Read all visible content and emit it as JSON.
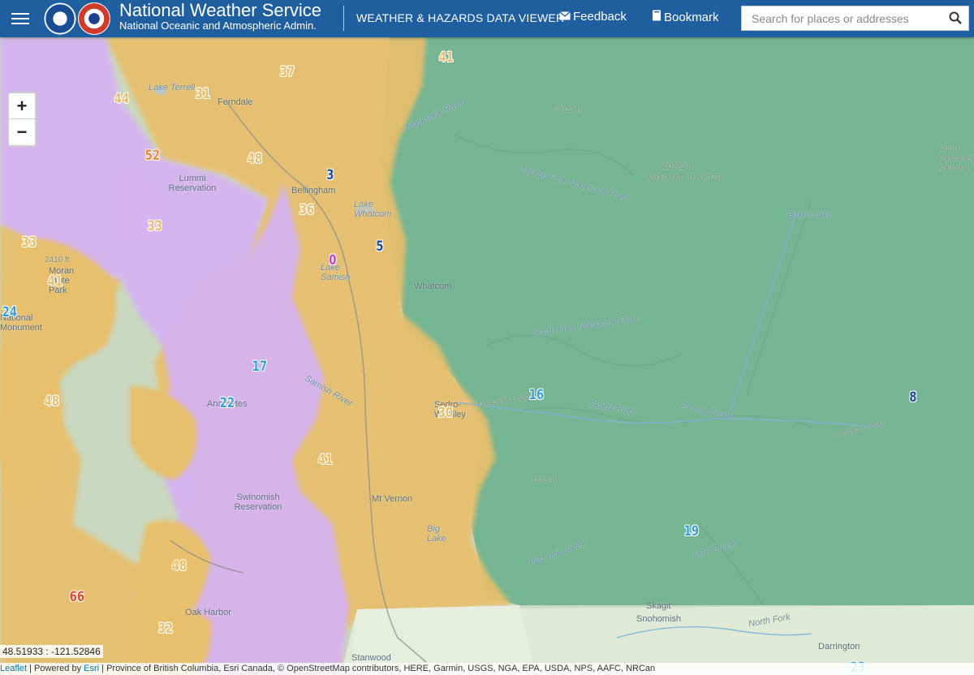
{
  "header": {
    "title": "National Weather Service",
    "subtitle": "National Oceanic and Atmospheric Admin.",
    "viewer_title": "WEATHER & HAZARDS DATA VIEWER",
    "feedback_label": "Feedback",
    "bookmark_label": "Bookmark",
    "search_placeholder": "Search for places or addresses",
    "color": "#1f5fa0"
  },
  "zoom": {
    "in_label": "+",
    "out_label": "−"
  },
  "map": {
    "colors": {
      "lavender": "#d6b4f0",
      "gold": "#e8bf6c",
      "green": "#6fb28f",
      "base": "#c9d8bf"
    },
    "places": {
      "lake_terrell": "Lake Terrell",
      "ferndale": "Ferndale",
      "lummi": "Lummi Reservation",
      "bellingham": "Bellingham",
      "lake_whatcom": "Lake Whatcom",
      "lake_samish": "Lake Samish",
      "whatcom": "Whatcom",
      "moran": "Moran State Park",
      "national_monument": "National Monument",
      "anacortes": "Anacortes",
      "samish_river": "Samish River",
      "sedro_woolley": "Sedro-Woolley",
      "swinomish": "Swinomish Reservation",
      "mt_vernon": "Mt Vernon",
      "big_lake": "Big Lake",
      "oak_harbor": "Oak Harbor",
      "stanwood": "Stanwood",
      "skagit": "Skagit",
      "snohomish": "Snohomish",
      "darrington": "Darrington",
      "north_fork": "North Fork",
      "mount_baker": "MOUNT BAKER",
      "baker_lake": "Baker Lake",
      "north_cascades": "North Cascades National",
      "skagit_river": "Skagit River",
      "cascade_loop": "Cascade Loop",
      "cascade_loop_2": "Cascade Loop",
      "elev_5020": "5020 ft",
      "elev_10762": "10762 ft",
      "elev_2410": "2410 ft",
      "elev_4144": "4144 ft",
      "nooksack_river": "Nooksack River",
      "middle_fork": "Middle Fork Nooksack River",
      "south_fork": "South Fork Nooksack River",
      "pilchuck": "Pilchuck Creek",
      "finney_creek": "Finney Creek",
      "lyre_creek": "Lyre Creek"
    },
    "values": [
      {
        "id": "v1",
        "text": "41",
        "color": "#e8bf6c"
      },
      {
        "id": "v2",
        "text": "37",
        "color": "#e8bf6c"
      },
      {
        "id": "v3",
        "text": "44",
        "color": "#e8bf6c"
      },
      {
        "id": "v4",
        "text": "31",
        "color": "#e8bf6c"
      },
      {
        "id": "v5",
        "text": "52",
        "color": "#f08a2e"
      },
      {
        "id": "v6",
        "text": "48",
        "color": "#e8bf6c"
      },
      {
        "id": "v7",
        "text": "3",
        "color": "#1f4e9c"
      },
      {
        "id": "v8",
        "text": "33",
        "color": "#e8bf6c"
      },
      {
        "id": "v9",
        "text": "36",
        "color": "#e8bf6c"
      },
      {
        "id": "v10",
        "text": "33",
        "color": "#e8bf6c"
      },
      {
        "id": "v11",
        "text": "41",
        "color": "#e8bf6c"
      },
      {
        "id": "v12",
        "text": "0",
        "color": "#c93fc9"
      },
      {
        "id": "v13",
        "text": "5",
        "color": "#1f4e9c"
      },
      {
        "id": "v14",
        "text": "24",
        "color": "#3aa0d6"
      },
      {
        "id": "v15",
        "text": "17",
        "color": "#3aa0d6"
      },
      {
        "id": "v16",
        "text": "48",
        "color": "#e8bf6c"
      },
      {
        "id": "v17",
        "text": "22",
        "color": "#3aa0d6"
      },
      {
        "id": "v18",
        "text": "16",
        "color": "#3aa0d6"
      },
      {
        "id": "v19",
        "text": "8",
        "color": "#1f4e9c"
      },
      {
        "id": "v20",
        "text": "30",
        "color": "#e8bf6c"
      },
      {
        "id": "v21",
        "text": "41",
        "color": "#e8bf6c"
      },
      {
        "id": "v22",
        "text": "19",
        "color": "#3aa0d6"
      },
      {
        "id": "v23",
        "text": "48",
        "color": "#e8bf6c"
      },
      {
        "id": "v24",
        "text": "66",
        "color": "#e04a2a"
      },
      {
        "id": "v25",
        "text": "32",
        "color": "#e8bf6c"
      },
      {
        "id": "v26",
        "text": "23",
        "color": "#3aa0d6"
      }
    ]
  },
  "coords": "48.51933 : -121.52846",
  "attribution": {
    "leaflet": "Leaflet",
    "sep1": " | Powered by ",
    "esri": "Esri",
    "rest": " | Province of British Columbia, Esri Canada, © OpenStreetMap contributors, HERE, Garmin, USGS, NGA, EPA, USDA, NPS, AAFC, NRCan"
  }
}
